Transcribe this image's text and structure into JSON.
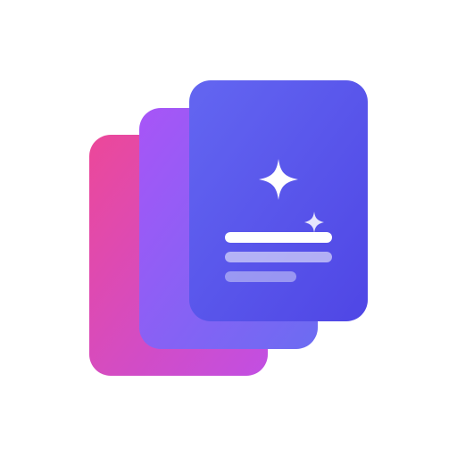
{
  "icon": {
    "name": "stacked-cards-sparkle-logo",
    "cards": [
      {
        "name": "back-card",
        "color_start": "#EC4899",
        "color_end": "#C14FE3"
      },
      {
        "name": "middle-card",
        "color_start": "#A855F7",
        "color_end": "#6B6CF2"
      },
      {
        "name": "front-card",
        "color_start": "#6366F1",
        "color_end": "#4F46E5"
      }
    ],
    "sparkles": [
      "sparkle-large-icon",
      "sparkle-small-icon"
    ],
    "text_lines": {
      "primary_color": "#FFFFFF",
      "secondary_color": "#FFFFFF"
    },
    "background_color": "#FFFFFF"
  }
}
